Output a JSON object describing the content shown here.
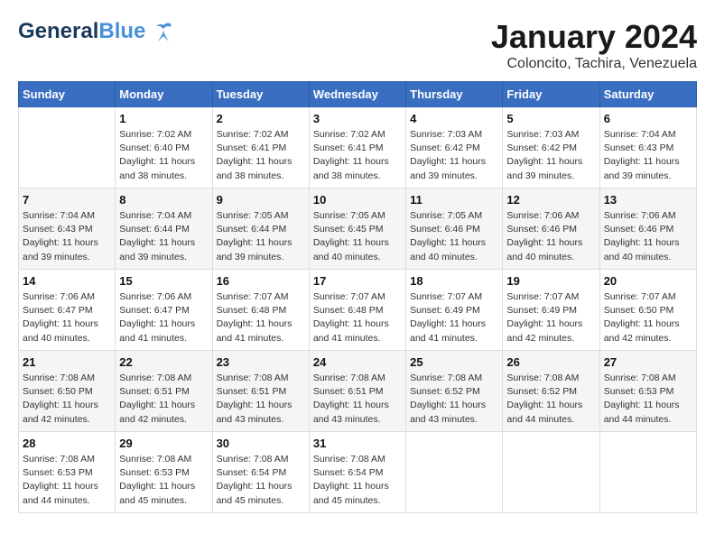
{
  "header": {
    "logo_general": "General",
    "logo_blue": "Blue",
    "month_title": "January 2024",
    "location": "Coloncito, Tachira, Venezuela"
  },
  "days_of_week": [
    "Sunday",
    "Monday",
    "Tuesday",
    "Wednesday",
    "Thursday",
    "Friday",
    "Saturday"
  ],
  "weeks": [
    [
      {
        "day": "",
        "sunrise": "",
        "sunset": "",
        "daylight": ""
      },
      {
        "day": "1",
        "sunrise": "Sunrise: 7:02 AM",
        "sunset": "Sunset: 6:40 PM",
        "daylight": "Daylight: 11 hours and 38 minutes."
      },
      {
        "day": "2",
        "sunrise": "Sunrise: 7:02 AM",
        "sunset": "Sunset: 6:41 PM",
        "daylight": "Daylight: 11 hours and 38 minutes."
      },
      {
        "day": "3",
        "sunrise": "Sunrise: 7:02 AM",
        "sunset": "Sunset: 6:41 PM",
        "daylight": "Daylight: 11 hours and 38 minutes."
      },
      {
        "day": "4",
        "sunrise": "Sunrise: 7:03 AM",
        "sunset": "Sunset: 6:42 PM",
        "daylight": "Daylight: 11 hours and 39 minutes."
      },
      {
        "day": "5",
        "sunrise": "Sunrise: 7:03 AM",
        "sunset": "Sunset: 6:42 PM",
        "daylight": "Daylight: 11 hours and 39 minutes."
      },
      {
        "day": "6",
        "sunrise": "Sunrise: 7:04 AM",
        "sunset": "Sunset: 6:43 PM",
        "daylight": "Daylight: 11 hours and 39 minutes."
      }
    ],
    [
      {
        "day": "7",
        "sunrise": "Sunrise: 7:04 AM",
        "sunset": "Sunset: 6:43 PM",
        "daylight": "Daylight: 11 hours and 39 minutes."
      },
      {
        "day": "8",
        "sunrise": "Sunrise: 7:04 AM",
        "sunset": "Sunset: 6:44 PM",
        "daylight": "Daylight: 11 hours and 39 minutes."
      },
      {
        "day": "9",
        "sunrise": "Sunrise: 7:05 AM",
        "sunset": "Sunset: 6:44 PM",
        "daylight": "Daylight: 11 hours and 39 minutes."
      },
      {
        "day": "10",
        "sunrise": "Sunrise: 7:05 AM",
        "sunset": "Sunset: 6:45 PM",
        "daylight": "Daylight: 11 hours and 40 minutes."
      },
      {
        "day": "11",
        "sunrise": "Sunrise: 7:05 AM",
        "sunset": "Sunset: 6:46 PM",
        "daylight": "Daylight: 11 hours and 40 minutes."
      },
      {
        "day": "12",
        "sunrise": "Sunrise: 7:06 AM",
        "sunset": "Sunset: 6:46 PM",
        "daylight": "Daylight: 11 hours and 40 minutes."
      },
      {
        "day": "13",
        "sunrise": "Sunrise: 7:06 AM",
        "sunset": "Sunset: 6:46 PM",
        "daylight": "Daylight: 11 hours and 40 minutes."
      }
    ],
    [
      {
        "day": "14",
        "sunrise": "Sunrise: 7:06 AM",
        "sunset": "Sunset: 6:47 PM",
        "daylight": "Daylight: 11 hours and 40 minutes."
      },
      {
        "day": "15",
        "sunrise": "Sunrise: 7:06 AM",
        "sunset": "Sunset: 6:47 PM",
        "daylight": "Daylight: 11 hours and 41 minutes."
      },
      {
        "day": "16",
        "sunrise": "Sunrise: 7:07 AM",
        "sunset": "Sunset: 6:48 PM",
        "daylight": "Daylight: 11 hours and 41 minutes."
      },
      {
        "day": "17",
        "sunrise": "Sunrise: 7:07 AM",
        "sunset": "Sunset: 6:48 PM",
        "daylight": "Daylight: 11 hours and 41 minutes."
      },
      {
        "day": "18",
        "sunrise": "Sunrise: 7:07 AM",
        "sunset": "Sunset: 6:49 PM",
        "daylight": "Daylight: 11 hours and 41 minutes."
      },
      {
        "day": "19",
        "sunrise": "Sunrise: 7:07 AM",
        "sunset": "Sunset: 6:49 PM",
        "daylight": "Daylight: 11 hours and 42 minutes."
      },
      {
        "day": "20",
        "sunrise": "Sunrise: 7:07 AM",
        "sunset": "Sunset: 6:50 PM",
        "daylight": "Daylight: 11 hours and 42 minutes."
      }
    ],
    [
      {
        "day": "21",
        "sunrise": "Sunrise: 7:08 AM",
        "sunset": "Sunset: 6:50 PM",
        "daylight": "Daylight: 11 hours and 42 minutes."
      },
      {
        "day": "22",
        "sunrise": "Sunrise: 7:08 AM",
        "sunset": "Sunset: 6:51 PM",
        "daylight": "Daylight: 11 hours and 42 minutes."
      },
      {
        "day": "23",
        "sunrise": "Sunrise: 7:08 AM",
        "sunset": "Sunset: 6:51 PM",
        "daylight": "Daylight: 11 hours and 43 minutes."
      },
      {
        "day": "24",
        "sunrise": "Sunrise: 7:08 AM",
        "sunset": "Sunset: 6:51 PM",
        "daylight": "Daylight: 11 hours and 43 minutes."
      },
      {
        "day": "25",
        "sunrise": "Sunrise: 7:08 AM",
        "sunset": "Sunset: 6:52 PM",
        "daylight": "Daylight: 11 hours and 43 minutes."
      },
      {
        "day": "26",
        "sunrise": "Sunrise: 7:08 AM",
        "sunset": "Sunset: 6:52 PM",
        "daylight": "Daylight: 11 hours and 44 minutes."
      },
      {
        "day": "27",
        "sunrise": "Sunrise: 7:08 AM",
        "sunset": "Sunset: 6:53 PM",
        "daylight": "Daylight: 11 hours and 44 minutes."
      }
    ],
    [
      {
        "day": "28",
        "sunrise": "Sunrise: 7:08 AM",
        "sunset": "Sunset: 6:53 PM",
        "daylight": "Daylight: 11 hours and 44 minutes."
      },
      {
        "day": "29",
        "sunrise": "Sunrise: 7:08 AM",
        "sunset": "Sunset: 6:53 PM",
        "daylight": "Daylight: 11 hours and 45 minutes."
      },
      {
        "day": "30",
        "sunrise": "Sunrise: 7:08 AM",
        "sunset": "Sunset: 6:54 PM",
        "daylight": "Daylight: 11 hours and 45 minutes."
      },
      {
        "day": "31",
        "sunrise": "Sunrise: 7:08 AM",
        "sunset": "Sunset: 6:54 PM",
        "daylight": "Daylight: 11 hours and 45 minutes."
      },
      {
        "day": "",
        "sunrise": "",
        "sunset": "",
        "daylight": ""
      },
      {
        "day": "",
        "sunrise": "",
        "sunset": "",
        "daylight": ""
      },
      {
        "day": "",
        "sunrise": "",
        "sunset": "",
        "daylight": ""
      }
    ]
  ]
}
